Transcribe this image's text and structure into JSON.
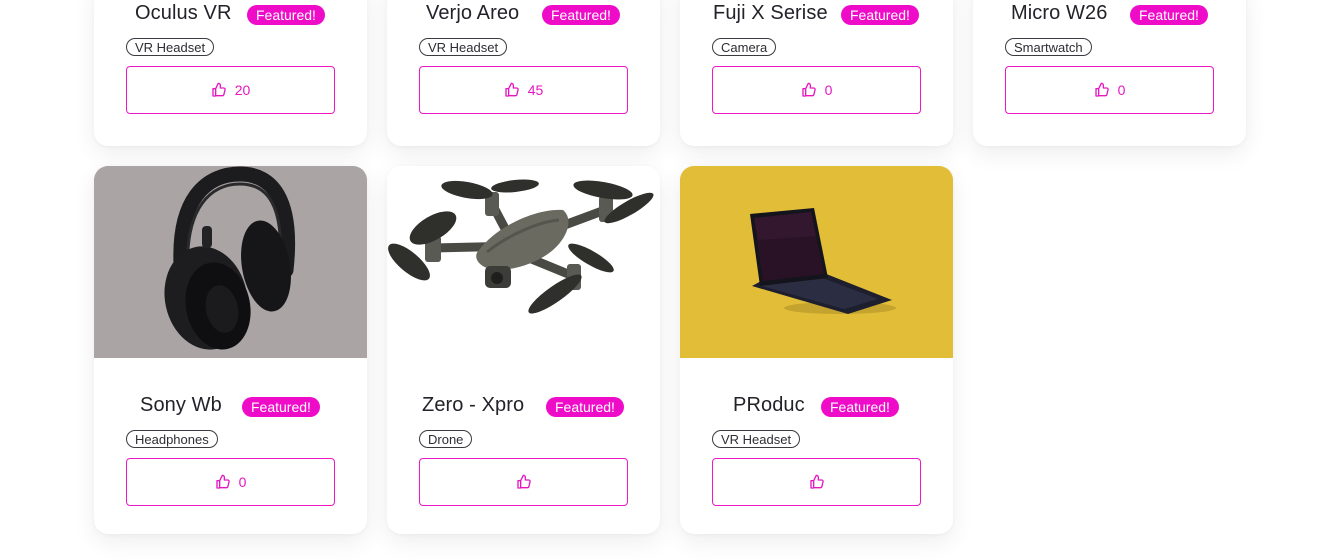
{
  "brand_color": "#ee0cc8",
  "like_icon": "thumbs-up-icon",
  "products": [
    {
      "name": "Oculus VR",
      "badge": "Featured!",
      "category": "VR Headset",
      "likes": "20"
    },
    {
      "name": "Verjo Areo",
      "badge": "Featured!",
      "category": "VR Headset",
      "likes": "45"
    },
    {
      "name": "Fuji X Serise",
      "badge": "Featured!",
      "category": "Camera",
      "likes": "0"
    },
    {
      "name": "Micro W26",
      "badge": "Featured!",
      "category": "Smartwatch",
      "likes": "0"
    },
    {
      "name": "Sony Wb",
      "badge": "Featured!",
      "category": "Headphones",
      "likes": "0",
      "image": "headphones-image"
    },
    {
      "name": "Zero - Xpro",
      "badge": "Featured!",
      "category": "Drone",
      "likes": "",
      "image": "drone-image"
    },
    {
      "name": "PRoduc",
      "badge": "Featured!",
      "category": "VR Headset",
      "likes": "",
      "image": "laptop-image"
    }
  ]
}
